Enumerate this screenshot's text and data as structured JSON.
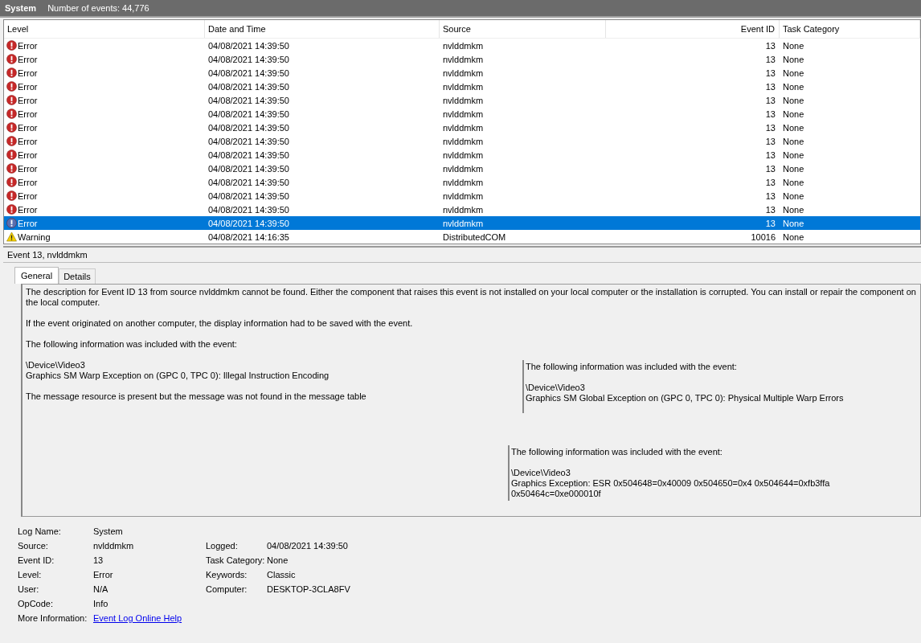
{
  "header": {
    "title": "System",
    "count": "Number of events: 44,776"
  },
  "table": {
    "columns": [
      "Level",
      "Date and Time",
      "Source",
      "Event ID",
      "Task Category"
    ],
    "rows": [
      {
        "kind": "error",
        "level": "Error",
        "date": "04/08/2021 14:39:50",
        "source": "nvlddmkm",
        "event_id": "13",
        "category": "None",
        "selected": false
      },
      {
        "kind": "error",
        "level": "Error",
        "date": "04/08/2021 14:39:50",
        "source": "nvlddmkm",
        "event_id": "13",
        "category": "None",
        "selected": false
      },
      {
        "kind": "error",
        "level": "Error",
        "date": "04/08/2021 14:39:50",
        "source": "nvlddmkm",
        "event_id": "13",
        "category": "None",
        "selected": false
      },
      {
        "kind": "error",
        "level": "Error",
        "date": "04/08/2021 14:39:50",
        "source": "nvlddmkm",
        "event_id": "13",
        "category": "None",
        "selected": false
      },
      {
        "kind": "error",
        "level": "Error",
        "date": "04/08/2021 14:39:50",
        "source": "nvlddmkm",
        "event_id": "13",
        "category": "None",
        "selected": false
      },
      {
        "kind": "error",
        "level": "Error",
        "date": "04/08/2021 14:39:50",
        "source": "nvlddmkm",
        "event_id": "13",
        "category": "None",
        "selected": false
      },
      {
        "kind": "error",
        "level": "Error",
        "date": "04/08/2021 14:39:50",
        "source": "nvlddmkm",
        "event_id": "13",
        "category": "None",
        "selected": false
      },
      {
        "kind": "error",
        "level": "Error",
        "date": "04/08/2021 14:39:50",
        "source": "nvlddmkm",
        "event_id": "13",
        "category": "None",
        "selected": false
      },
      {
        "kind": "error",
        "level": "Error",
        "date": "04/08/2021 14:39:50",
        "source": "nvlddmkm",
        "event_id": "13",
        "category": "None",
        "selected": false
      },
      {
        "kind": "error",
        "level": "Error",
        "date": "04/08/2021 14:39:50",
        "source": "nvlddmkm",
        "event_id": "13",
        "category": "None",
        "selected": false
      },
      {
        "kind": "error",
        "level": "Error",
        "date": "04/08/2021 14:39:50",
        "source": "nvlddmkm",
        "event_id": "13",
        "category": "None",
        "selected": false
      },
      {
        "kind": "error",
        "level": "Error",
        "date": "04/08/2021 14:39:50",
        "source": "nvlddmkm",
        "event_id": "13",
        "category": "None",
        "selected": false
      },
      {
        "kind": "error",
        "level": "Error",
        "date": "04/08/2021 14:39:50",
        "source": "nvlddmkm",
        "event_id": "13",
        "category": "None",
        "selected": false
      },
      {
        "kind": "error",
        "level": "Error",
        "date": "04/08/2021 14:39:50",
        "source": "nvlddmkm",
        "event_id": "13",
        "category": "None",
        "selected": true
      },
      {
        "kind": "warning",
        "level": "Warning",
        "date": "04/08/2021 14:16:35",
        "source": "DistributedCOM",
        "event_id": "10016",
        "category": "None",
        "selected": false
      }
    ]
  },
  "details": {
    "title": "Event 13, nvlddmkm",
    "tabs": [
      {
        "label": "General",
        "selected": true
      },
      {
        "label": "Details",
        "selected": false
      }
    ],
    "description": [
      "The description for Event ID 13 from source nvlddmkm cannot be found. Either the component that raises this event is not installed on your local computer or the installation is corrupted. You can install or repair the component on the local computer.",
      "If the event originated on another computer, the display information had to be saved with the event.",
      "The following information was included with the event:"
    ],
    "main_block": [
      "\\Device\\Video3",
      "Graphics SM Warp Exception on (GPC 0, TPC 0): Illegal Instruction Encoding",
      "The message resource is present but the message was not found in the message table"
    ],
    "info_blocks": [
      {
        "heading": "The following information was included with the event:",
        "lines": [
          "\\Device\\Video3",
          "Graphics SM Global Exception on (GPC 0, TPC 0): Physical Multiple Warp Errors"
        ]
      },
      {
        "heading": "The following information was included with the event:",
        "lines": [
          "\\Device\\Video3",
          "Graphics Exception: ESR 0x504648=0x40009 0x504650=0x4 0x504644=0xfb3ffa 0x50464c=0xe000010f"
        ]
      }
    ],
    "fields": [
      {
        "label": "Log Name:",
        "value": "System"
      },
      {
        "label": "Source:",
        "value": "nvlddmkm",
        "label2": "Logged:",
        "value2": "04/08/2021 14:39:50"
      },
      {
        "label": "Event ID:",
        "value": "13",
        "label2": "Task Category:",
        "value2": "None"
      },
      {
        "label": "Level:",
        "value": "Error",
        "label2": "Keywords:",
        "value2": "Classic"
      },
      {
        "label": "User:",
        "value": "N/A",
        "label2": "Computer:",
        "value2": "DESKTOP-3CLA8FV"
      },
      {
        "label": "OpCode:",
        "value": "Info"
      },
      {
        "label": "More Information:",
        "value": "Event Log Online Help",
        "kind": "link"
      }
    ]
  }
}
